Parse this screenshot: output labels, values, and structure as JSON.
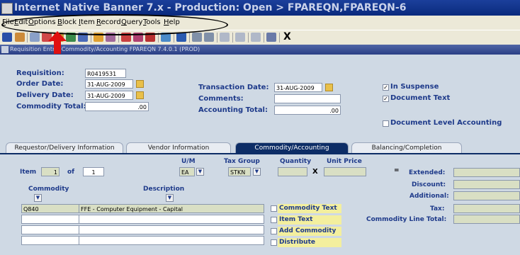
{
  "window": {
    "title": "Internet Native Banner 7.x - Production: Open > FPAREQN,FPAREQN-6"
  },
  "menubar": {
    "items": [
      {
        "label": "File",
        "key": "F"
      },
      {
        "label": "Edit",
        "key": "E"
      },
      {
        "label": "Options",
        "key": "O"
      },
      {
        "label": "Block",
        "key": "B"
      },
      {
        "label": "Item",
        "key": "I"
      },
      {
        "label": "Record",
        "key": "R"
      },
      {
        "label": "Query",
        "key": "Q"
      },
      {
        "label": "Tools",
        "key": "T"
      },
      {
        "label": "Help",
        "key": "H"
      }
    ]
  },
  "toolbar": {
    "exit_label": "X"
  },
  "form": {
    "header": "Requisition Entry: Commodity/Accounting  FPAREQN  7.4.0.1  (PROD)"
  },
  "main": {
    "requisition_label": "Requisition:",
    "requisition_value": "R0419531",
    "order_date_label": "Order Date:",
    "order_date_value": "31-AUG-2009",
    "delivery_date_label": "Delivery Date:",
    "delivery_date_value": "31-AUG-2009",
    "commodity_total_label": "Commodity Total:",
    "commodity_total_value": ".00",
    "transaction_date_label": "Transaction Date:",
    "transaction_date_value": "31-AUG-2009",
    "comments_label": "Comments:",
    "comments_value": "",
    "accounting_total_label": "Accounting Total:",
    "accounting_total_value": ".00",
    "in_suspense_label": "In Suspense",
    "in_suspense_checked": true,
    "document_text_label": "Document Text",
    "document_text_checked": true,
    "doc_level_accounting_label": "Document Level Accounting",
    "doc_level_accounting_checked": false
  },
  "tabs": [
    {
      "label": "Requestor/Delivery Information",
      "active": false
    },
    {
      "label": "Vendor Information",
      "active": false
    },
    {
      "label": "Commodity/Accounting",
      "active": true
    },
    {
      "label": "Balancing/Completion",
      "active": false
    }
  ],
  "commodity": {
    "item_label": "Item",
    "item_value": "1",
    "of_label": "of",
    "of_value": "1",
    "um_header": "U/M",
    "um_value": "EA",
    "tax_group_header": "Tax Group",
    "tax_group_value": "STKN",
    "quantity_header": "Quantity",
    "unit_price_header": "Unit Price",
    "times_symbol": "X",
    "equals_symbol": "=",
    "commodity_header": "Commodity",
    "description_header": "Description",
    "rows": [
      {
        "commodity": "Q840",
        "description": "FFE - Computer Equipment - Capital"
      },
      {
        "commodity": "",
        "description": ""
      },
      {
        "commodity": "",
        "description": ""
      },
      {
        "commodity": "",
        "description": ""
      }
    ],
    "commodity_text_label": "Commodity Text",
    "item_text_label": "Item Text",
    "add_commodity_label": "Add Commodity",
    "distribute_label": "Distribute",
    "extended_label": "Extended:",
    "discount_label": "Discount:",
    "additional_label": "Additional:",
    "tax_label": "Tax:",
    "line_total_label": "Commodity Line Total:"
  }
}
